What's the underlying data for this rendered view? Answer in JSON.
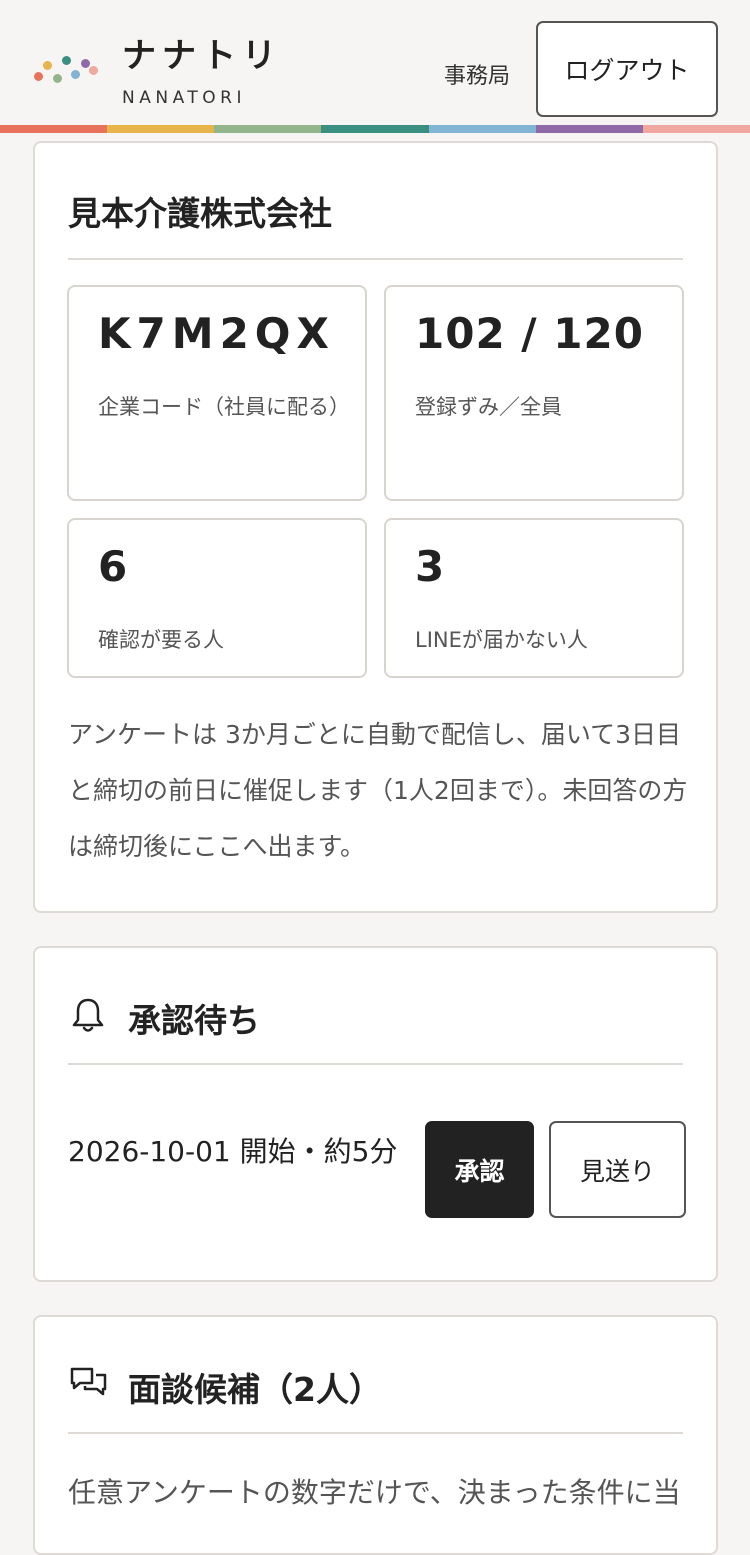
{
  "header": {
    "logo_title": "ナナトリ",
    "logo_subtitle": "NANATORI",
    "role": "事務局",
    "logout_label": "ログアウト"
  },
  "brand_colors": [
    "#e8735c",
    "#e8b44c",
    "#93b58b",
    "#3a8f80",
    "#82b4d4",
    "#8f6aa6",
    "#efa7a0"
  ],
  "company": {
    "name": "見本介護株式会社",
    "stats": [
      {
        "value": "K7M2QX",
        "label": "企業コード（社員に配る）"
      },
      {
        "value": "102 / 120",
        "label": "登録ずみ／全員"
      },
      {
        "value": "6",
        "label": "確認が要る人"
      },
      {
        "value": "3",
        "label": "LINEが届かない人"
      }
    ],
    "note": "アンケートは 3か月ごとに自動で配信し、届いて3日目と締切の前日に催促します（1人2回まで）。未回答の方は締切後にここへ出ます。"
  },
  "approval": {
    "title": "承認待ち",
    "icon": "bell-icon",
    "item": "2026-10-01 開始・約5分",
    "approve_label": "承認",
    "skip_label": "見送り"
  },
  "interviews": {
    "title": "面談候補（2人）",
    "icon": "chat-bubbles-icon",
    "description": "任意アンケートの数字だけで、決まった条件に当"
  }
}
